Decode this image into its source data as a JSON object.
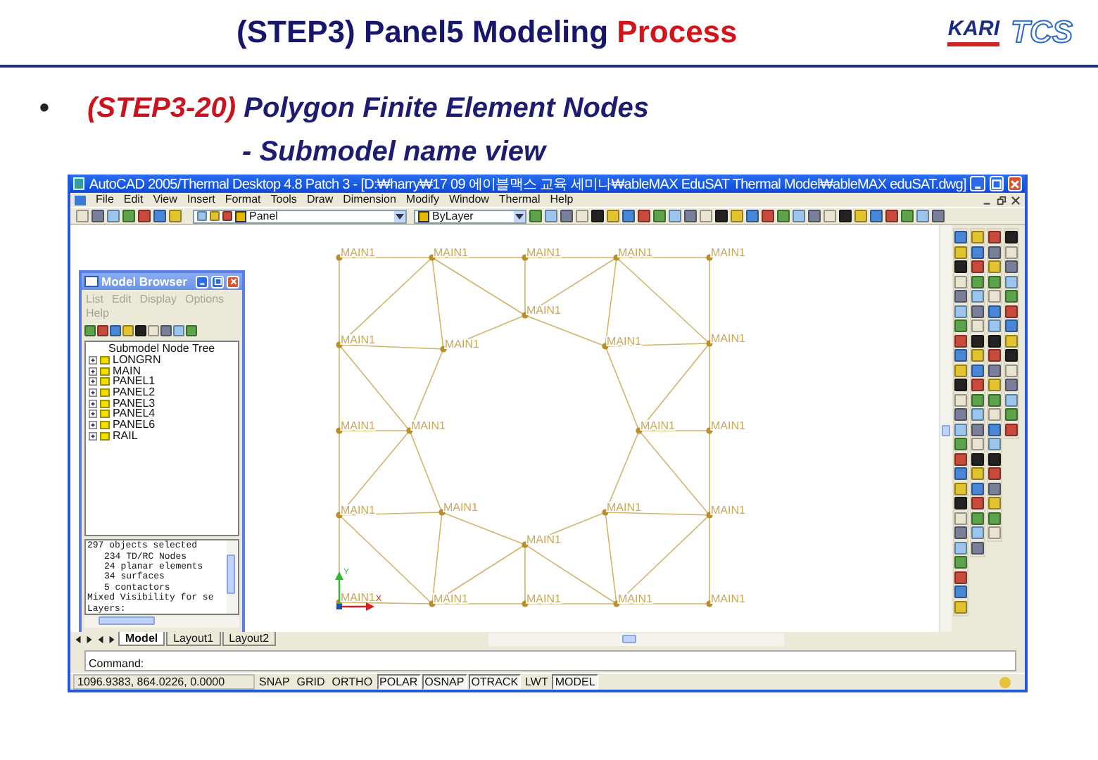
{
  "slide": {
    "title": {
      "text": "(STEP3) Panel5 Modeling",
      "accent": "Process"
    },
    "logos": [
      {
        "kind": "kari",
        "text": "KARI"
      },
      {
        "kind": "tcs",
        "text": "TCS"
      }
    ],
    "bullet": {
      "marker": "•",
      "tag": "(STEP3-20)",
      "text": "Polygon Finite Element Nodes"
    },
    "subheading": "- Submodel name view"
  },
  "window": {
    "title": "AutoCAD 2005/Thermal Desktop 4.8 Patch 3 - [D:₩harry₩17 09 에이블맥스 교육 세미나₩ableMAX EduSAT Thermal Model₩ableMAX eduSAT.dwg]",
    "menu": [
      "File",
      "Edit",
      "View",
      "Insert",
      "Format",
      "Tools",
      "Draw",
      "Dimension",
      "Modify",
      "Window",
      "Thermal",
      "Help"
    ],
    "layer": "Panel",
    "color_control": "ByLayer"
  },
  "nodes": [
    "MAIN1",
    "MAIN1",
    "MAIN1",
    "MAIN1",
    "MAIN1",
    "MAIN1",
    "MAIN1",
    "MAIN1",
    "MAIN1",
    "MAIN1",
    "MAIN1",
    "MAIN1",
    "MAIN1",
    "MAIN1",
    "MAIN1",
    "MAIN1",
    "MAIN1",
    "MAIN1",
    "MAIN1",
    "MAIN1",
    "MAIN1",
    "MAIN1",
    "MAIN1",
    "MAIN1"
  ],
  "ucs": {
    "x": "X",
    "y": "Y"
  },
  "model_browser": {
    "title": "Model Browser",
    "menu": [
      {
        "label": "List",
        "disabled": true
      },
      {
        "label": "Edit",
        "disabled": true
      },
      {
        "label": "Display",
        "disabled": true
      },
      {
        "label": "Options",
        "disabled": true
      },
      {
        "label": "Help",
        "disabled": true
      }
    ],
    "tree_title": "Submodel Node Tree",
    "tree": [
      {
        "label": "LONGRN",
        "expanded": false
      },
      {
        "label": "MAIN",
        "expanded": false
      },
      {
        "label": "PANEL1",
        "expanded": false
      },
      {
        "label": "PANEL2",
        "expanded": false
      },
      {
        "label": "PANEL3",
        "expanded": false
      },
      {
        "label": "PANEL4",
        "expanded": false
      },
      {
        "label": "PANEL6",
        "expanded": false
      },
      {
        "label": "RAIL",
        "expanded": false
      }
    ],
    "info": [
      {
        "text": "297 objects selected",
        "indent": false
      },
      {
        "text": "234 TD/RC Nodes",
        "indent": true
      },
      {
        "text": "24 planar elements",
        "indent": true
      },
      {
        "text": "34 surfaces",
        "indent": true
      },
      {
        "text": "5 contactors",
        "indent": true
      },
      {
        "text": "Mixed Visibility for se",
        "indent": false
      },
      {
        "text": "Layers:",
        "indent": false
      }
    ]
  },
  "layout_tabs": [
    {
      "label": "Model",
      "selected": true
    },
    {
      "label": "Layout1",
      "selected": false
    },
    {
      "label": "Layout2",
      "selected": false
    }
  ],
  "command": "Command:",
  "status": {
    "coords": "1096.9383, 864.0226, 0.0000",
    "toggles": [
      {
        "label": "SNAP",
        "on": false
      },
      {
        "label": "GRID",
        "on": false
      },
      {
        "label": "ORTHO",
        "on": false
      },
      {
        "label": "POLAR",
        "on": true
      },
      {
        "label": "OSNAP",
        "on": true
      },
      {
        "label": "OTRACK",
        "on": true
      },
      {
        "label": "LWT",
        "on": false
      },
      {
        "label": "MODEL",
        "on": true
      }
    ]
  }
}
